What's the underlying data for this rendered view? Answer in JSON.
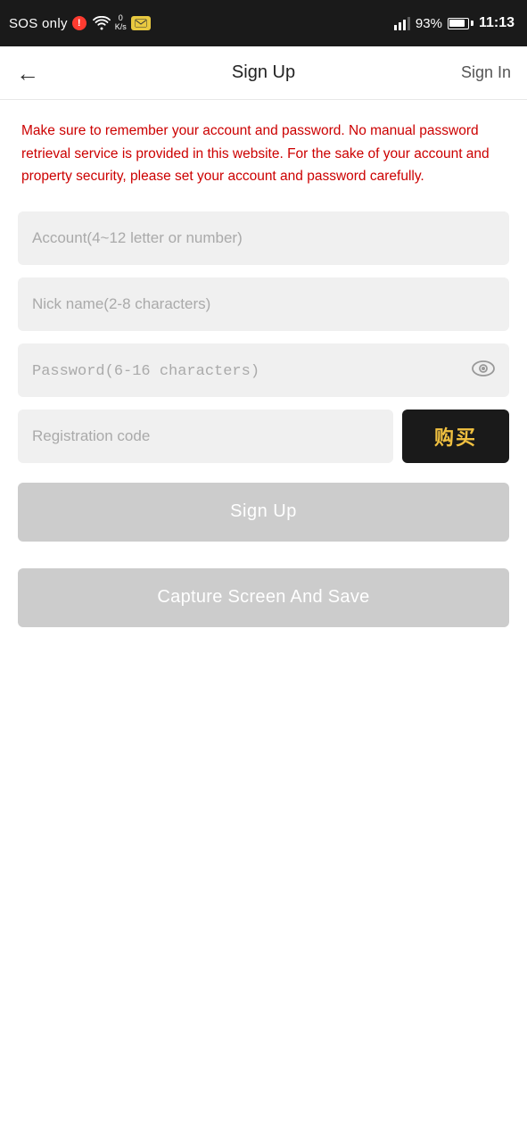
{
  "statusBar": {
    "sosLabel": "SOS only",
    "dataSpeed": "0\nK/s",
    "batteryPercent": "93%",
    "time": "11:13"
  },
  "navBar": {
    "title": "Sign Up",
    "signInLabel": "Sign In",
    "backIcon": "←"
  },
  "warningText": "Make sure to remember your account and password. No manual password retrieval service is provided in this website. For the sake of your account and property security, please set your account and password carefully.",
  "form": {
    "accountPlaceholder": "Account(4~12 letter or number)",
    "nicknamePlaceholder": "Nick name(2-8 characters)",
    "passwordPlaceholder": "Password(6-16 characters)",
    "regCodePlaceholder": "Registration code",
    "buyButtonLabel": "购买",
    "signUpButtonLabel": "Sign Up",
    "captureButtonLabel": "Capture Screen And Save",
    "eyeIcon": "👁"
  }
}
